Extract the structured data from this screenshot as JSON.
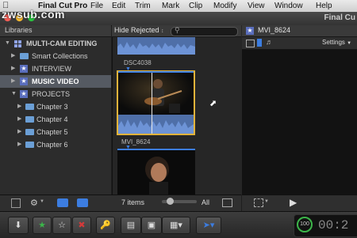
{
  "menubar": {
    "app_label": "Final Cut Pro",
    "items": [
      "File",
      "Edit",
      "Trim",
      "Mark",
      "Clip",
      "Modify",
      "View",
      "Window",
      "Help"
    ]
  },
  "watermark": "zwsub.com",
  "window": {
    "app_title": "Final Cu"
  },
  "libraries": {
    "header": "Libraries",
    "library_name": "MULTI-CAM EDITING",
    "items": [
      {
        "label": "Smart Collections"
      },
      {
        "label": "INTERVIEW"
      },
      {
        "label": "MUSIC VIDEO"
      },
      {
        "label": "PROJECTS"
      },
      {
        "label": "Chapter 3"
      },
      {
        "label": "Chapter 4"
      },
      {
        "label": "Chapter 5"
      },
      {
        "label": "Chapter 6"
      }
    ]
  },
  "browser": {
    "filter": "Hide Rejected",
    "clips": [
      {
        "label": "DSC4038"
      },
      {
        "label": "MVI_8624"
      }
    ],
    "footer_count": "7 items",
    "footer_all": "All"
  },
  "viewer": {
    "title": "MVI_8624",
    "settings": "Settings"
  },
  "timecode": {
    "percent": "100"
  },
  "colors": {
    "accent": "#5a6ebd",
    "selection": "#555a62",
    "blue_tool": "#3c7de0",
    "green": "#3cb54a",
    "red": "#d43a3a"
  }
}
